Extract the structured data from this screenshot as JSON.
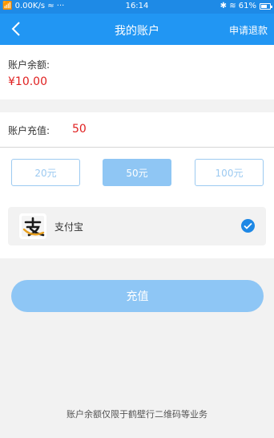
{
  "status_bar": {
    "left": "📶 0.00K/s ≈ ···",
    "time": "16:14",
    "right": "✱ ≋ 61%",
    "battery_percent": 61
  },
  "header": {
    "back_icon": "chevron-left-icon",
    "title": "我的账户",
    "action": "申请退款"
  },
  "balance": {
    "label": "账户余额:",
    "value": "¥10.00"
  },
  "recharge": {
    "label": "账户充值:",
    "value": "50"
  },
  "amount_options": [
    {
      "label": "20元",
      "selected": false
    },
    {
      "label": "50元",
      "selected": true
    },
    {
      "label": "100元",
      "selected": false
    }
  ],
  "payment": {
    "name": "支付宝",
    "logo_icon": "alipay-logo-icon",
    "check_icon": "check-circle-icon"
  },
  "submit": {
    "label": "充值"
  },
  "footer": {
    "note": "账户余额仅限于鹤壁行二维码等业务"
  },
  "colors": {
    "header": "#2196f3",
    "status_bar": "#1e8ae6",
    "accent_red": "#e02020",
    "light_blue": "#8ec6f5",
    "check_blue": "#1e88e5"
  }
}
